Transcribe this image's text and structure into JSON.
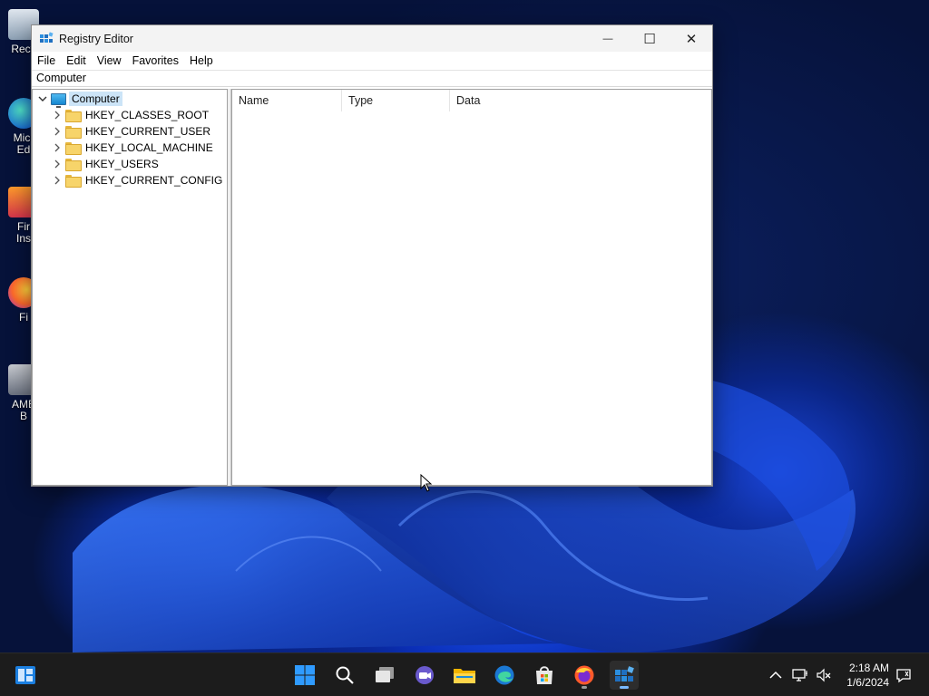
{
  "window": {
    "title": "Registry Editor",
    "minimize_glyph": "—",
    "maximize_glyph": "☐",
    "close_glyph": "✕"
  },
  "menu": {
    "items": [
      "File",
      "Edit",
      "View",
      "Favorites",
      "Help"
    ]
  },
  "address": {
    "path": "Computer"
  },
  "tree": {
    "root": "Computer",
    "children": [
      "HKEY_CLASSES_ROOT",
      "HKEY_CURRENT_USER",
      "HKEY_LOCAL_MACHINE",
      "HKEY_USERS",
      "HKEY_CURRENT_CONFIG"
    ]
  },
  "list": {
    "columns": [
      "Name",
      "Type",
      "Data"
    ]
  },
  "desktop": {
    "icons": [
      {
        "label": "Recy",
        "icon": "recycle-bin-icon"
      },
      {
        "label": "Micr\nEd",
        "icon": "edge-icon"
      },
      {
        "label": "Fir\nIns",
        "icon": "firefox-installer-icon"
      },
      {
        "label": "Fi",
        "icon": "firefox-icon"
      },
      {
        "label": "AME\nB",
        "icon": "ame-icon"
      }
    ]
  },
  "taskbar": {
    "time": "2:18 AM",
    "date": "1/6/2024"
  },
  "colors": {
    "selection": "#cce4f7",
    "taskbar": "#1c1c1c",
    "accent": "#0078d4"
  }
}
